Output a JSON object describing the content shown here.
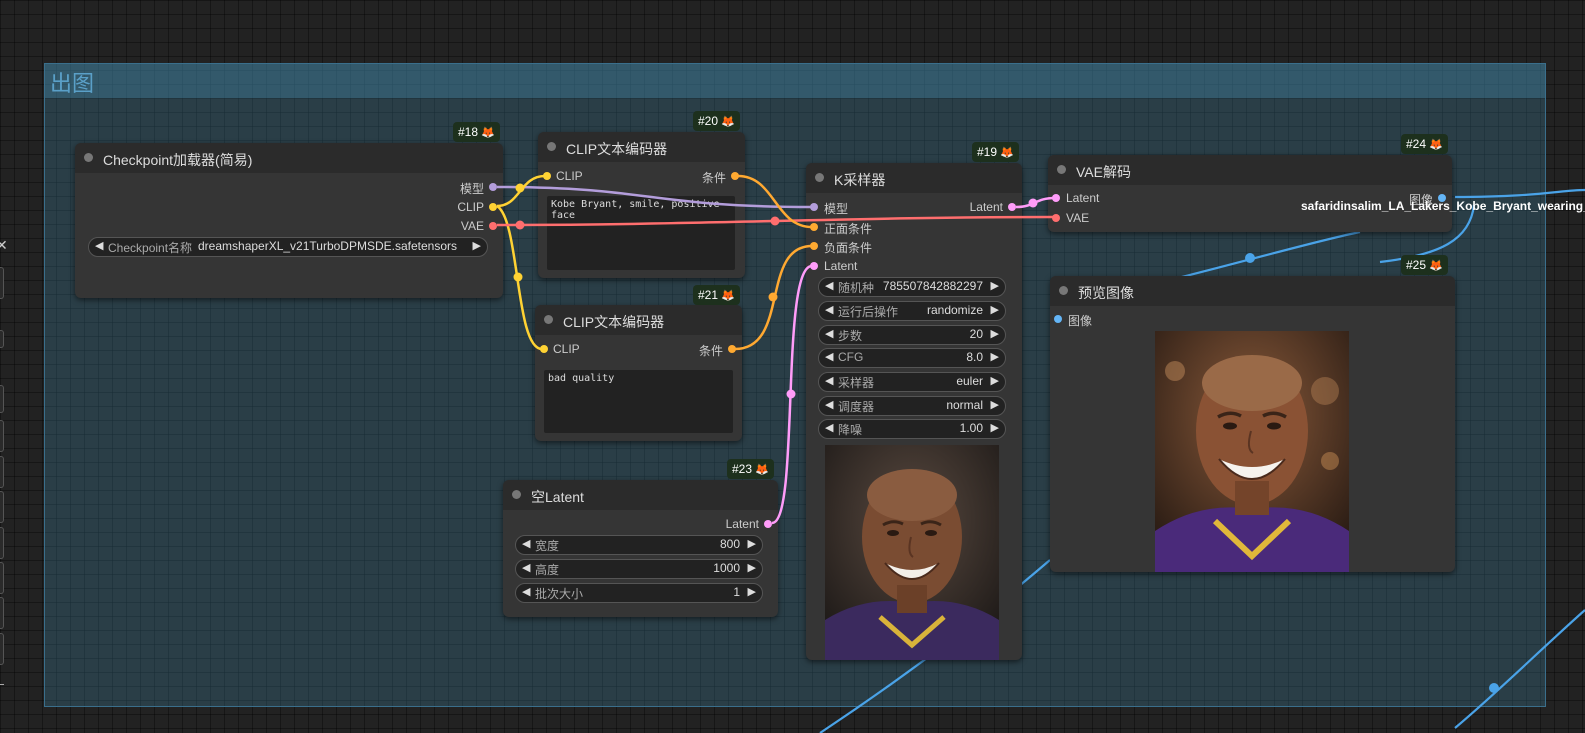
{
  "group": {
    "title": "出图"
  },
  "nodes": {
    "checkpoint": {
      "badge_id": "#18",
      "title": "Checkpoint加载器(简易)",
      "outputs": [
        "模型",
        "CLIP",
        "VAE"
      ],
      "widget": {
        "label": "Checkpoint名称",
        "value": "dreamshaperXL_v21TurboDPMSDE.safetensors"
      }
    },
    "clip_pos": {
      "badge_id": "#20",
      "title": "CLIP文本编码器",
      "input": "CLIP",
      "output": "条件",
      "text": "Kobe Bryant, smile, positive face"
    },
    "clip_neg": {
      "badge_id": "#21",
      "title": "CLIP文本编码器",
      "input": "CLIP",
      "output": "条件",
      "text": "bad quality"
    },
    "empty_latent": {
      "badge_id": "#23",
      "title": "空Latent",
      "output": "Latent",
      "widgets": [
        {
          "label": "宽度",
          "value": "800"
        },
        {
          "label": "高度",
          "value": "1000"
        },
        {
          "label": "批次大小",
          "value": "1"
        }
      ]
    },
    "ksampler": {
      "badge_id": "#19",
      "title": "K采样器",
      "inputs": [
        "模型",
        "正面条件",
        "负面条件",
        "Latent"
      ],
      "output": "Latent",
      "widgets": [
        {
          "label": "随机种",
          "value": "785507842882297"
        },
        {
          "label": "运行后操作",
          "value": "randomize"
        },
        {
          "label": "步数",
          "value": "20"
        },
        {
          "label": "CFG",
          "value": "8.0"
        },
        {
          "label": "采样器",
          "value": "euler"
        },
        {
          "label": "调度器",
          "value": "normal"
        },
        {
          "label": "降噪",
          "value": "1.00"
        }
      ]
    },
    "vae_decode": {
      "badge_id": "#24",
      "title": "VAE解码",
      "inputs": [
        "Latent",
        "VAE"
      ],
      "output": "图像",
      "filename": "safaridinsalim_LA_Lakers_Kobe_Bryant_wearing_"
    },
    "preview": {
      "badge_id": "#25",
      "title": "预览图像",
      "input": "图像"
    }
  },
  "colors": {
    "model": "#b39ddb",
    "clip": "#ffd233",
    "vae": "#ff6e6e",
    "conditioning": "#ffa931",
    "latent": "#ff9cf9",
    "image": "#64b5f6"
  },
  "icons": {
    "badge": "fox-icon",
    "widget_left": "arrow-left-icon",
    "widget_right": "arrow-right-icon"
  }
}
